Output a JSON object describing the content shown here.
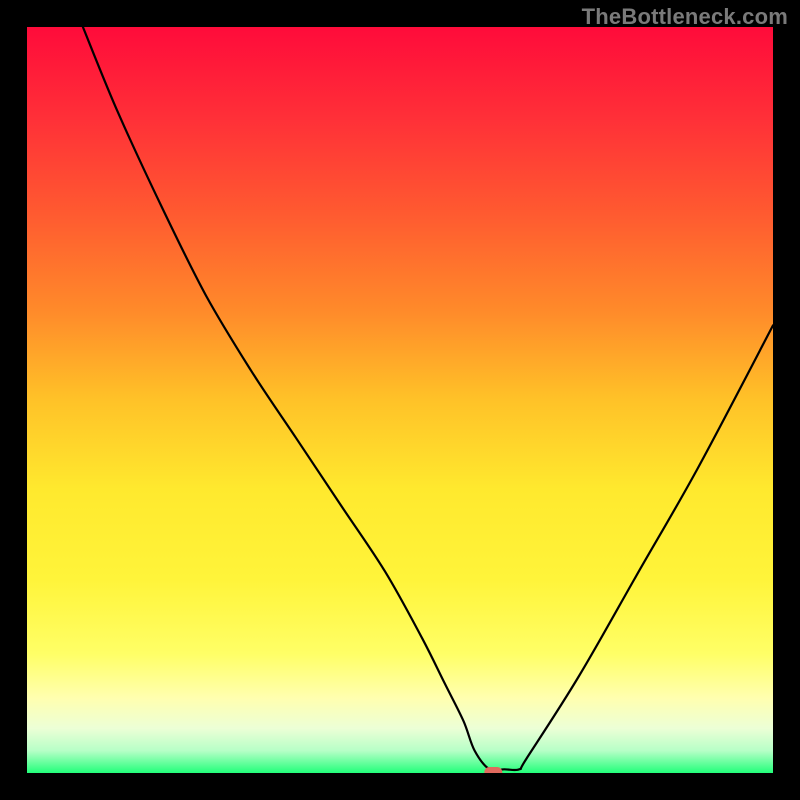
{
  "watermark": "TheBottleneck.com",
  "chart_data": {
    "type": "line",
    "title": "",
    "xlabel": "",
    "ylabel": "",
    "xlim": [
      0,
      100
    ],
    "ylim": [
      0,
      100
    ],
    "grid": false,
    "legend": false,
    "background": {
      "type": "vertical-gradient",
      "stops": [
        {
          "offset": 0.0,
          "color": "#ff0b3a"
        },
        {
          "offset": 0.12,
          "color": "#ff2f38"
        },
        {
          "offset": 0.25,
          "color": "#ff5a30"
        },
        {
          "offset": 0.38,
          "color": "#ff8a2a"
        },
        {
          "offset": 0.5,
          "color": "#ffc228"
        },
        {
          "offset": 0.62,
          "color": "#ffe92e"
        },
        {
          "offset": 0.74,
          "color": "#fff43a"
        },
        {
          "offset": 0.84,
          "color": "#ffff66"
        },
        {
          "offset": 0.9,
          "color": "#ffffb0"
        },
        {
          "offset": 0.94,
          "color": "#ecffd6"
        },
        {
          "offset": 0.97,
          "color": "#b7ffc7"
        },
        {
          "offset": 1.0,
          "color": "#22ff7a"
        }
      ]
    },
    "series": [
      {
        "name": "bottleneck-curve",
        "x": [
          7.5,
          12,
          18,
          24,
          30,
          36,
          42,
          48,
          53,
          56,
          58.5,
          60,
          62,
          64,
          66,
          67,
          74,
          82,
          90,
          100
        ],
        "y": [
          100,
          89,
          76,
          64,
          54,
          45,
          36,
          27,
          18,
          12,
          7,
          3,
          0.5,
          0.5,
          0.5,
          2,
          13,
          27,
          41,
          60
        ]
      }
    ],
    "marker": {
      "name": "optimal-point",
      "x": 62.5,
      "y": 0,
      "color": "#e06a5e",
      "size": [
        18,
        10
      ]
    }
  }
}
